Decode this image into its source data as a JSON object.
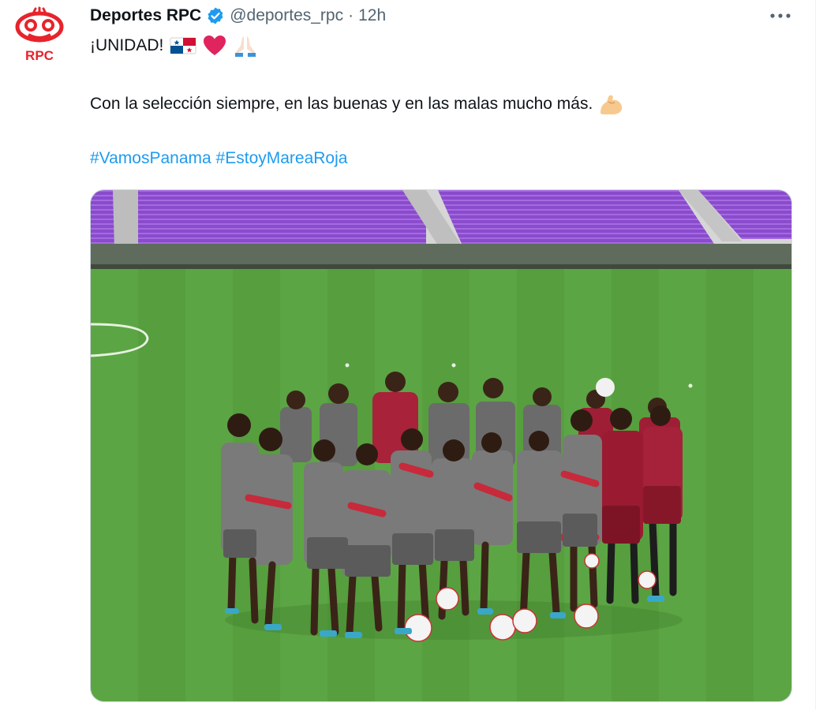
{
  "tweet": {
    "author": {
      "display_name": "Deportes RPC",
      "handle": "@deportes_rpc",
      "avatar_text": "RPC",
      "verified": true
    },
    "separator": "·",
    "time": "12h",
    "text_line1": "¡UNIDAD!",
    "emojis_line1": [
      "panama-flag",
      "red-heart",
      "folded-hands"
    ],
    "text_line2": "Con la selección siempre, en las buenas y en las malas mucho más.",
    "emojis_line2": [
      "flexed-biceps"
    ],
    "hashtags": [
      "#VamosPanama",
      "#EstoyMareaRoja"
    ],
    "media": {
      "type": "photo"
    }
  },
  "colors": {
    "brand_red": "#e8232b",
    "link_blue": "#1d9bf0",
    "secondary_text": "#536471",
    "stadium_seats": "#8e4fd1",
    "pitch_green": "#58a140"
  }
}
